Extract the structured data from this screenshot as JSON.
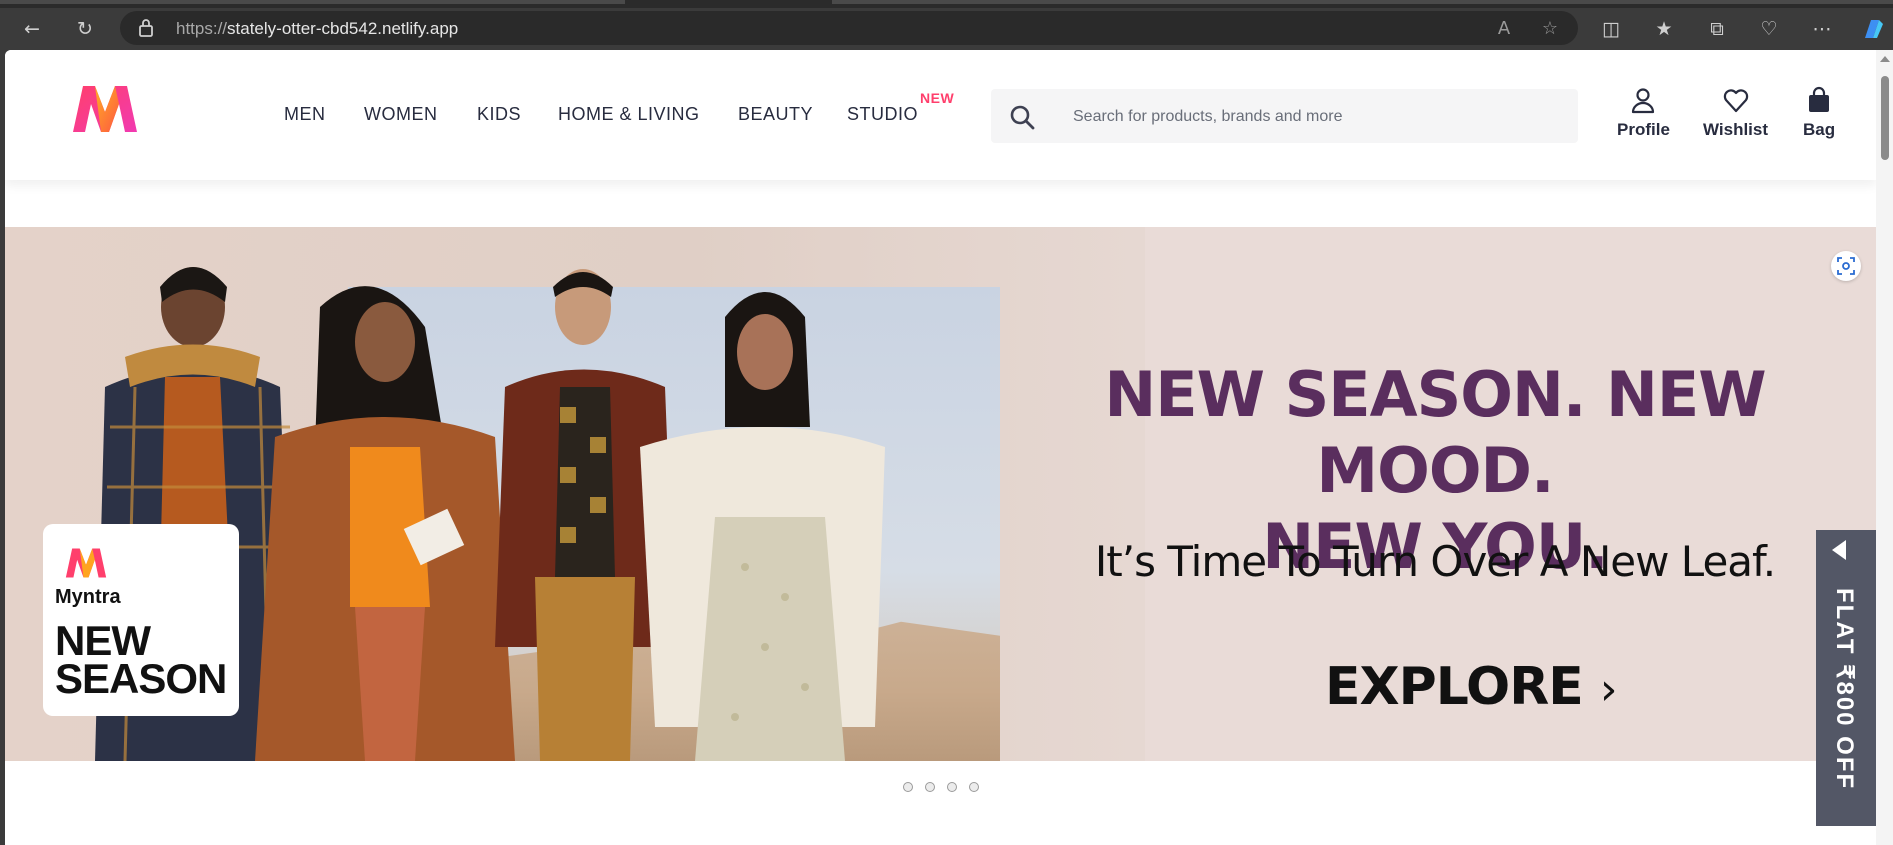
{
  "browser": {
    "url_protocol": "https://",
    "url_host": "stately-otter-cbd542.netlify.app"
  },
  "header": {
    "nav": [
      "MEN",
      "WOMEN",
      "KIDS",
      "HOME & LIVING",
      "BEAUTY",
      "STUDIO"
    ],
    "studio_badge": "NEW",
    "search_placeholder": "Search for products, brands and more",
    "actions": {
      "profile": "Profile",
      "wishlist": "Wishlist",
      "bag": "Bag"
    },
    "brand_colors": {
      "pink": "#ff3f6c",
      "orange": "#f79a1e",
      "text": "#282c3f"
    }
  },
  "banner": {
    "headline_1": "NEW SEASON. NEW MOOD.",
    "headline_2": "NEW YOU.",
    "subline": "It’s Time To Turn Over A New Leaf.",
    "cta": "EXPLORE",
    "cta_icon": "chevron-right",
    "card_brand": "Myntra",
    "card_title_1": "NEW",
    "card_title_2": "SEASON",
    "headline_color": "#5a2e5e",
    "slide_count": 4
  },
  "side_promo": {
    "text": "FLAT ₹800 OFF"
  }
}
